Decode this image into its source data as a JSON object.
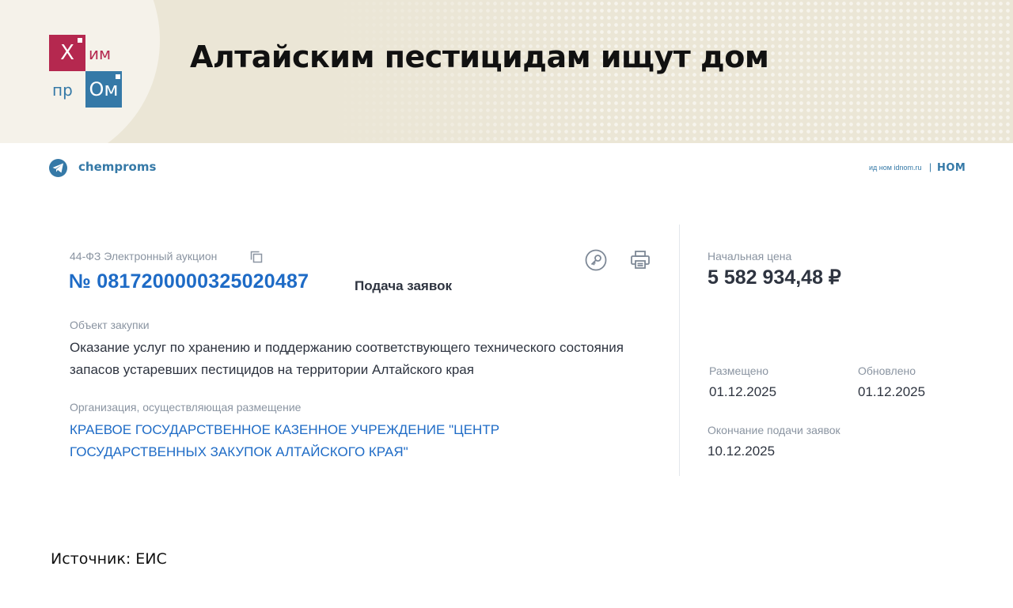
{
  "header": {
    "logo": {
      "top_left": "Х",
      "top_right": "им",
      "bottom_left": "пр",
      "bottom_right": "Ом"
    },
    "title": "Алтайским пестицидам ищут дом"
  },
  "social": {
    "icon": "telegram-icon",
    "handle": "chemproms"
  },
  "branding": {
    "idnom": "ид ном idnom.ru",
    "separator": "|",
    "nom": "НОМ"
  },
  "card": {
    "law_type": "44-ФЗ Электронный аукцион",
    "number": "№ 0817200000325020487",
    "status": "Подача заявок",
    "object_label": "Объект закупки",
    "object_text": "Оказание услуг по хранению и поддержанию соответствующего технического состояния запасов устаревших пестицидов на территории Алтайского края",
    "org_label": "Организация, осуществляющая размещение",
    "org_text": "КРАЕВОЕ ГОСУДАРСТВЕННОЕ КАЗЕННОЕ УЧРЕЖДЕНИЕ \"ЦЕНТР ГОСУДАРСТВЕННЫХ ЗАКУПОК АЛТАЙСКОГО КРАЯ\"",
    "price_label": "Начальная цена",
    "price": "5 582 934,48 ₽",
    "placed_label": "Размещено",
    "placed_date": "01.12.2025",
    "updated_label": "Обновлено",
    "updated_date": "01.12.2025",
    "deadline_label": "Окончание подачи заявок",
    "deadline_date": "10.12.2025"
  },
  "source": "Источник: ЕИС",
  "colors": {
    "brand_red": "#b5284f",
    "brand_blue": "#3579a7",
    "link_blue": "#1e6bc6"
  }
}
